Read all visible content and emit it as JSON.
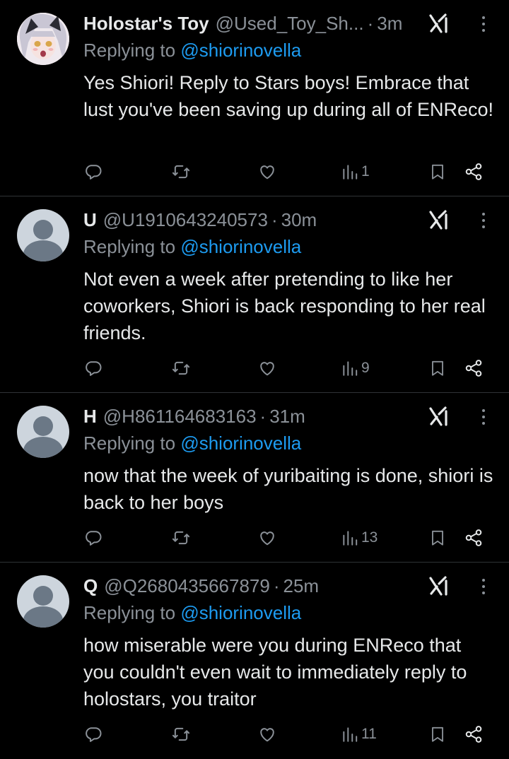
{
  "colors": {
    "background": "#000000",
    "primary_text": "#e7e9ea",
    "secondary_text": "#8b9198",
    "link": "#1d9bf0",
    "divider": "#2f3336"
  },
  "icons": {
    "reply": "comment-icon",
    "repost": "retweet-icon",
    "like": "heart-icon",
    "views": "views-icon",
    "bookmark": "bookmark-icon",
    "share": "share-icon",
    "grok": "grok-icon",
    "more": "more-icon"
  },
  "replies": [
    {
      "display_name": "Holostar's Toy",
      "handle": "@Used_Toy_Sh...",
      "separator": "·",
      "time": "3m",
      "replying_prefix": "Replying to",
      "replying_to": "@shiorinovella",
      "text": "Yes Shiori! Reply to Stars boys! Embrace that lust you've been saving up during all of ENReco!",
      "views": "1",
      "avatar": "anime-avatar"
    },
    {
      "display_name": "U",
      "handle": "@U1910643240573",
      "separator": "·",
      "time": "30m",
      "replying_prefix": "Replying to",
      "replying_to": "@shiorinovella",
      "text": "Not even a week after pretending to like her coworkers, Shiori is back responding to her real friends.",
      "views": "9",
      "avatar": "default-avatar"
    },
    {
      "display_name": "H",
      "handle": "@H861164683163",
      "separator": "·",
      "time": "31m",
      "replying_prefix": "Replying to",
      "replying_to": "@shiorinovella",
      "text": "now that the week of yuribaiting is done, shiori is back to her boys",
      "views": "13",
      "avatar": "default-avatar"
    },
    {
      "display_name": "Q",
      "handle": "@Q2680435667879",
      "separator": "·",
      "time": "25m",
      "replying_prefix": "Replying to",
      "replying_to": "@shiorinovella",
      "text": "how miserable were you during ENReco that you couldn't even wait to immediately reply to holostars, you traitor",
      "views": "11",
      "avatar": "default-avatar"
    }
  ]
}
